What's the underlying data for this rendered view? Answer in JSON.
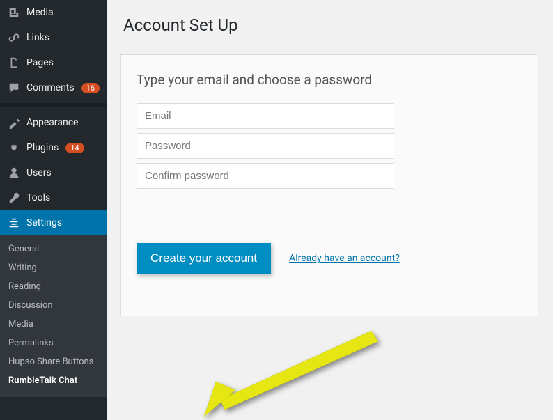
{
  "sidebar": {
    "items": [
      {
        "label": "Media",
        "icon": "media"
      },
      {
        "label": "Links",
        "icon": "link"
      },
      {
        "label": "Pages",
        "icon": "page"
      },
      {
        "label": "Comments",
        "icon": "comment",
        "badge": "16"
      },
      {
        "label": "Appearance",
        "icon": "appearance"
      },
      {
        "label": "Plugins",
        "icon": "plugin",
        "badge": "14"
      },
      {
        "label": "Users",
        "icon": "user"
      },
      {
        "label": "Tools",
        "icon": "tool"
      },
      {
        "label": "Settings",
        "icon": "settings",
        "active": true
      }
    ],
    "submenu": [
      "General",
      "Writing",
      "Reading",
      "Discussion",
      "Media",
      "Permalinks",
      "Hupso Share Buttons",
      "RumbleTalk Chat"
    ],
    "submenu_current": "RumbleTalk Chat"
  },
  "page": {
    "title": "Account Set Up",
    "panel_heading": "Type your email and choose a password",
    "email_placeholder": "Email",
    "password_placeholder": "Password",
    "confirm_placeholder": "Confirm password",
    "create_button": "Create your account",
    "already_link": "Already have an account?"
  },
  "colors": {
    "accent": "#0073aa",
    "button": "#008ec2",
    "badge": "#d54e21",
    "arrow": "#e6e612"
  }
}
